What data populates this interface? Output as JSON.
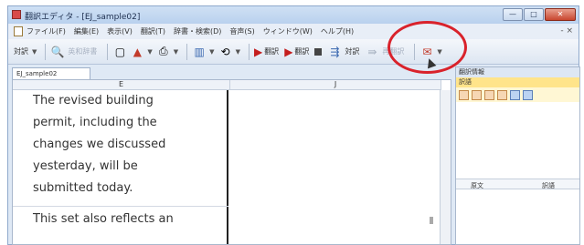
{
  "window": {
    "title": "翻訳エディタ - [EJ_sample02]",
    "controls": [
      "—",
      "□",
      "✕"
    ]
  },
  "menubar": {
    "items": [
      "ファイル(F)",
      "編集(E)",
      "表示(V)",
      "翻訳(T)",
      "辞書・検索(D)",
      "音声(S)",
      "ウィンドウ(W)",
      "ヘルプ(H)"
    ],
    "right": "- ×"
  },
  "toolbar": {
    "mode_label": "対訳",
    "search_dim": "英和辞書",
    "translate": "翻訳",
    "translate_next": "翻訳",
    "parallel": "対訳",
    "retranslate_dim": "再翻訳"
  },
  "document": {
    "tab_label": "EJ_sample02",
    "col_e": "E",
    "col_j": "J",
    "cell_text_lines": [
      "The revised building",
      "permit, including the",
      "changes we discussed",
      "yesterday, will be",
      "submitted today."
    ],
    "cell_text_lines_2": [
      "This set also reflects an"
    ]
  },
  "side_panel": {
    "header": "翻訳情報",
    "tab": "訳語",
    "list_col_original": "原文",
    "list_col_term": "訳語"
  }
}
